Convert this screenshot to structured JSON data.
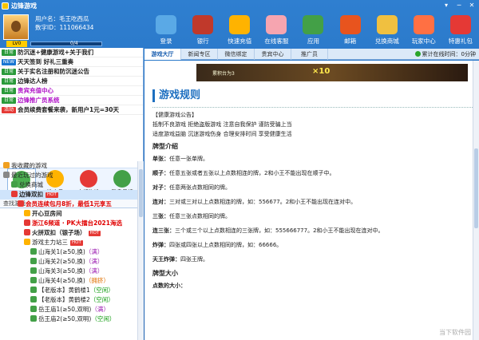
{
  "window": {
    "title": "边锋游戏",
    "buttons": [
      "▾",
      "─",
      "✕"
    ]
  },
  "user": {
    "name_label": "用户名：",
    "name": "毛王吃西瓜",
    "id_label": "数字ID：",
    "id": "111066434",
    "vip_label": "LV0",
    "progress_text": "0/4",
    "progress": 0.0
  },
  "toolbar": [
    {
      "label": "登录",
      "icon": "monitor-icon",
      "color": "#5aa9e6"
    },
    {
      "label": "银行",
      "icon": "wallet-icon",
      "color": "#c0392b"
    },
    {
      "label": "快速充值",
      "icon": "coin-icon",
      "color": "#ffb300"
    },
    {
      "label": "在线客服",
      "icon": "service-avatar-icon",
      "color": "#f6a5b0"
    },
    {
      "label": "应用",
      "icon": "apps-icon",
      "color": "#43a047"
    },
    {
      "label": "邮箱",
      "icon": "mail-icon",
      "color": "#e8541e"
    },
    {
      "label": "兑换商城",
      "icon": "shop-icon",
      "color": "#f0c040"
    },
    {
      "label": "玩家中心",
      "icon": "player-center-icon",
      "color": "#ff7043"
    },
    {
      "label": "特惠礼包",
      "icon": "gift-icon",
      "color": "#e53935"
    }
  ],
  "notices": [
    {
      "tag": "日常",
      "type": "daily",
      "text": "防沉迷+健康游戏+关于我们",
      "style": "bold"
    },
    {
      "tag": "NEW",
      "type": "new",
      "text": "天天签到 好礼三重奏",
      "style": "bold"
    },
    {
      "tag": "日常",
      "type": "daily",
      "text": "关于实名注册和防沉迷公告",
      "style": "bold"
    },
    {
      "tag": "日常",
      "type": "daily",
      "text": "边锋达人榜",
      "style": "bold"
    },
    {
      "tag": "日常",
      "type": "daily",
      "text": "贵宾充值中心",
      "style": "purple"
    },
    {
      "tag": "日常",
      "type": "daily",
      "text": "边锋推广员系统",
      "style": "purple"
    },
    {
      "tag": "活动",
      "type": "act",
      "text": "会员续费套餐来袭，新用户1元=30天",
      "style": "bold"
    }
  ],
  "categories": [
    {
      "label": "全部游戏",
      "icon": "all-games-icon",
      "color": "#4caf50",
      "active": true
    },
    {
      "label": "推广员",
      "icon": "promoter-trophy-icon",
      "color": "#ffb300",
      "active": false
    },
    {
      "label": "电视海选",
      "icon": "tv-icon",
      "color": "#e53935",
      "active": false
    },
    {
      "label": "复盘反馈",
      "icon": "chat-icon",
      "color": "#43a047",
      "active": false
    }
  ],
  "search_placeholder": "查找游戏",
  "tree": [
    {
      "text": "我收藏的游戏",
      "indent": 4,
      "icon_color": "#f0a020",
      "cls": "",
      "hot": false
    },
    {
      "text": "最近玩过的游戏",
      "indent": 4,
      "icon_color": "#888888",
      "cls": "",
      "hot": false
    },
    {
      "text": "兑换商城",
      "indent": 14,
      "icon_color": "#43a047",
      "cls": "",
      "hot": false
    },
    {
      "text": "边锋双扣",
      "indent": 14,
      "icon_color": "#e53935",
      "cls": "bold",
      "hot": true,
      "selected": true
    },
    {
      "text": "会员连续包月8折，最低1元享五",
      "indent": 22,
      "icon_color": "#e53935",
      "cls": "red",
      "hot": false
    },
    {
      "text": "开心豆房间",
      "indent": 30,
      "icon_color": "#ffb300",
      "cls": "bold",
      "hot": false
    },
    {
      "text": "浙江6频道 · PK大擂台2021海选",
      "indent": 30,
      "icon_color": "#e53935",
      "cls": "red",
      "hot": false
    },
    {
      "text": "火拼双扣（银子场）",
      "indent": 30,
      "icon_color": "#e53935",
      "cls": "bold",
      "hot": true
    },
    {
      "text": "游戏主力站三",
      "indent": 30,
      "icon_color": "#ffb300",
      "cls": "",
      "hot": true
    },
    {
      "text": "山海关1(≥50,换)",
      "indent": 38,
      "icon_color": "#43a047",
      "cls": "",
      "status": "（满）",
      "status_cls": "st-purple"
    },
    {
      "text": "山海关2(≥50,换)",
      "indent": 38,
      "icon_color": "#43a047",
      "cls": "",
      "status": "（满）",
      "status_cls": "st-purple"
    },
    {
      "text": "山海关3(≥50,换)",
      "indent": 38,
      "icon_color": "#43a047",
      "cls": "",
      "status": "（满）",
      "status_cls": "st-purple"
    },
    {
      "text": "山海关4(≥50,换)",
      "indent": 38,
      "icon_color": "#43a047",
      "cls": "",
      "status": "（拥挤）",
      "status_cls": "st-orange"
    },
    {
      "text": "【老版本】黄鹤楼1",
      "indent": 38,
      "icon_color": "#43a047",
      "cls": "",
      "status": "（空闲）",
      "status_cls": "st-green"
    },
    {
      "text": "【老版本】黄鹤楼2",
      "indent": 38,
      "icon_color": "#43a047",
      "cls": "",
      "status": "（空闲）",
      "status_cls": "st-green"
    },
    {
      "text": "岳王庙1(≥50,双明)",
      "indent": 38,
      "icon_color": "#43a047",
      "cls": "",
      "status": "（满）",
      "status_cls": "st-purple"
    },
    {
      "text": "岳王庙2(≥50,双明)",
      "indent": 38,
      "icon_color": "#43a047",
      "cls": "",
      "status": "（空闲）",
      "status_cls": "st-green"
    }
  ],
  "tabs": [
    {
      "label": "游戏大厅",
      "active": true
    },
    {
      "label": "新闻专区",
      "active": false
    },
    {
      "label": "微信绑定",
      "active": false
    },
    {
      "label": "贵宾中心",
      "active": false
    },
    {
      "label": "推广员",
      "active": false
    }
  ],
  "online": {
    "label": "累计在线时间：",
    "value": "0分钟"
  },
  "banner": {
    "text": "累积台为3",
    "multiplier": "×10"
  },
  "rules": {
    "title": "游戏规则",
    "notice_title": "【健康游戏公告】",
    "notice_lines": [
      "抵制不良游戏 拒绝盗版游戏 注意自我保护 谨防受骗上当",
      "适度游戏益脑 沉迷游戏伤身 合理安排时间 享受健康生活"
    ],
    "section1": "牌型介绍",
    "items": [
      {
        "name": "单张：",
        "desc": "任意一张单牌。"
      },
      {
        "name": "顺子：",
        "desc": "任意五张或者五张以上点数相连的牌，2和小王不能出现在顺子中。"
      },
      {
        "name": "对子：",
        "desc": "任意两张点数相同的牌。"
      },
      {
        "name": "连对：",
        "desc": "三对或三对以上点数相连的牌，如：556677。2和小王不能出现在连对中。"
      },
      {
        "name": "三张：",
        "desc": "任意三张点数相同的牌。"
      },
      {
        "name": "连三张：",
        "desc": "三个或三个以上点数相连的三张牌，如：555666777。2和小王不能出现在连对中。"
      },
      {
        "name": "炸弹：",
        "desc": "四张或四张以上点数相同的牌，如：66666。"
      },
      {
        "name": "天王炸弹：",
        "desc": "四张王牌。"
      }
    ],
    "section2": "牌型大小",
    "size_label": "点数的大小："
  },
  "watermark": "当下软件园"
}
